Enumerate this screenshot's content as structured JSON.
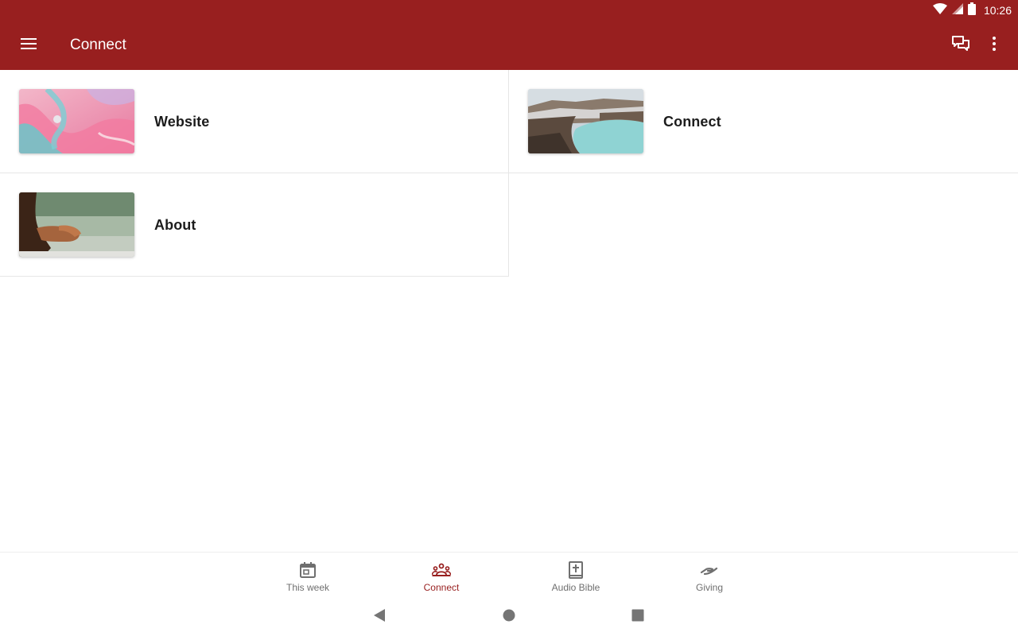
{
  "status_bar": {
    "time": "10:26",
    "icons": [
      "wifi-icon",
      "signal-icon",
      "battery-icon"
    ]
  },
  "app_bar": {
    "title": "Connect",
    "icons": [
      "menu-icon",
      "chat-icon",
      "more-vert-icon"
    ]
  },
  "tiles": [
    {
      "label": "Website",
      "thumbnail": "pink-marble-abstract"
    },
    {
      "label": "Connect",
      "thumbnail": "crater-lake-landscape"
    },
    {
      "label": "About",
      "thumbnail": "praying-hands-forest"
    }
  ],
  "bottom_nav": {
    "items": [
      {
        "label": "This week",
        "icon": "calendar-icon",
        "active": false
      },
      {
        "label": "Connect",
        "icon": "people-group-icon",
        "active": true
      },
      {
        "label": "Audio Bible",
        "icon": "bible-icon",
        "active": false
      },
      {
        "label": "Giving",
        "icon": "giving-hand-icon",
        "active": false
      }
    ]
  },
  "system_nav": [
    "back-icon",
    "home-icon",
    "recents-icon"
  ],
  "colors": {
    "brand": "#981f1f",
    "inactive": "#6f6f6f",
    "divider": "#e6e6e6"
  }
}
